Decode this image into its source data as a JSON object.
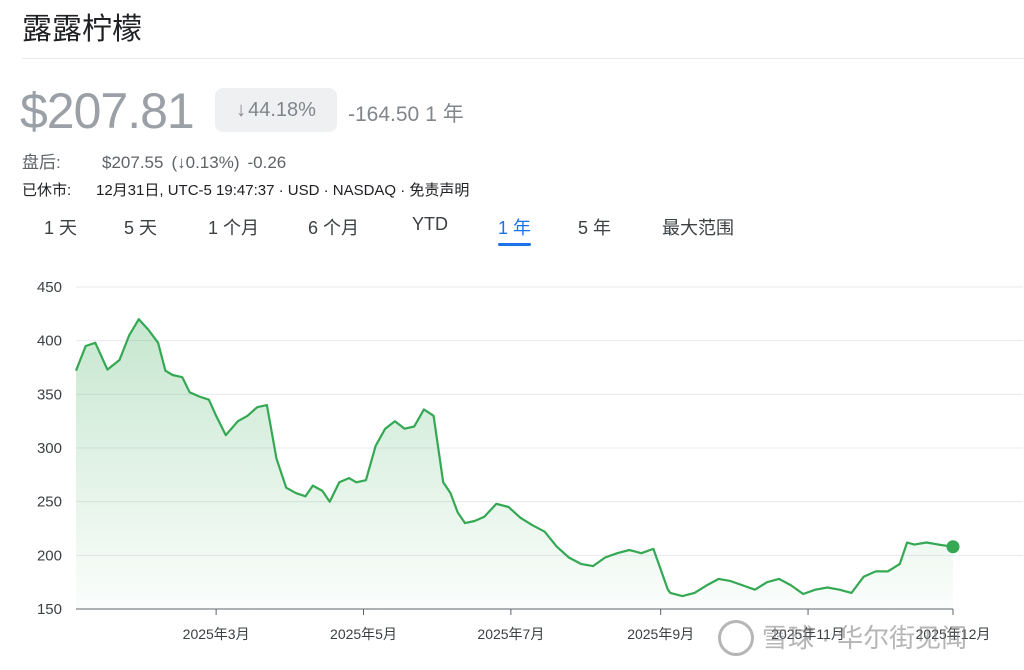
{
  "header": {
    "title": "露露柠檬"
  },
  "quote": {
    "price": "$207.81",
    "change_percent": "44.18%",
    "change_arrow": "↓",
    "change_abs": "-164.50",
    "period": "1 年"
  },
  "after_hours": {
    "label": "盘后:",
    "price": "$207.55",
    "change_percent": "(↓0.13%)",
    "change_abs": "-0.26"
  },
  "status": {
    "label": "已休市:",
    "text": "12月31日, UTC-5 19:47:37 · USD · NASDAQ · 免责声明"
  },
  "tabs": [
    {
      "label": "1 天",
      "active": false
    },
    {
      "label": "5 天",
      "active": false
    },
    {
      "label": "1 个月",
      "active": false
    },
    {
      "label": "6 个月",
      "active": false
    },
    {
      "label": "YTD",
      "active": false
    },
    {
      "label": "1 年",
      "active": true
    },
    {
      "label": "5 年",
      "active": false
    },
    {
      "label": "最大范围",
      "active": false
    }
  ],
  "watermark": {
    "text": "雪球 · 华尔街见闻"
  },
  "colors": {
    "line": "#34a853",
    "grid": "#e8eaed",
    "accent": "#1a73e8"
  },
  "chart_data": {
    "type": "area",
    "title": "",
    "xlabel": "",
    "ylabel": "",
    "ylim": [
      150,
      450
    ],
    "yticks": [
      150,
      200,
      250,
      300,
      350,
      400,
      450
    ],
    "xlim": [
      "2025-01-02",
      "2025-12-31"
    ],
    "xticks": [
      {
        "date": "2025-03-01",
        "label": "2025年3月"
      },
      {
        "date": "2025-05-01",
        "label": "2025年5月"
      },
      {
        "date": "2025-07-01",
        "label": "2025年7月"
      },
      {
        "date": "2025-09-01",
        "label": "2025年9月"
      },
      {
        "date": "2025-11-01",
        "label": "2025年11月"
      },
      {
        "date": "2025-12-31",
        "label": "2025年12月"
      }
    ],
    "grid": true,
    "series": [
      {
        "x": [
          "2025-01-02",
          "2025-01-06",
          "2025-01-10",
          "2025-01-15",
          "2025-01-20",
          "2025-01-24",
          "2025-01-28",
          "2025-02-01",
          "2025-02-05",
          "2025-02-08",
          "2025-02-11",
          "2025-02-15",
          "2025-02-18",
          "2025-02-22",
          "2025-02-26",
          "2025-03-01",
          "2025-03-05",
          "2025-03-10",
          "2025-03-14",
          "2025-03-18",
          "2025-03-22",
          "2025-03-26",
          "2025-03-30",
          "2025-04-03",
          "2025-04-07",
          "2025-04-10",
          "2025-04-14",
          "2025-04-17",
          "2025-04-21",
          "2025-04-25",
          "2025-04-28",
          "2025-05-02",
          "2025-05-06",
          "2025-05-10",
          "2025-05-14",
          "2025-05-18",
          "2025-05-22",
          "2025-05-26",
          "2025-05-30",
          "2025-06-03",
          "2025-06-06",
          "2025-06-09",
          "2025-06-12",
          "2025-06-16",
          "2025-06-20",
          "2025-06-25",
          "2025-06-30",
          "2025-07-05",
          "2025-07-10",
          "2025-07-15",
          "2025-07-20",
          "2025-07-25",
          "2025-07-30",
          "2025-08-04",
          "2025-08-09",
          "2025-08-14",
          "2025-08-19",
          "2025-08-24",
          "2025-08-29",
          "2025-09-04",
          "2025-09-05",
          "2025-09-10",
          "2025-09-15",
          "2025-09-20",
          "2025-09-25",
          "2025-09-30",
          "2025-10-05",
          "2025-10-10",
          "2025-10-15",
          "2025-10-20",
          "2025-10-25",
          "2025-10-30",
          "2025-11-04",
          "2025-11-09",
          "2025-11-14",
          "2025-11-19",
          "2025-11-24",
          "2025-11-29",
          "2025-12-04",
          "2025-12-09",
          "2025-12-12",
          "2025-12-15",
          "2025-12-20",
          "2025-12-25",
          "2025-12-31"
        ],
        "values": [
          372,
          395,
          398,
          373,
          382,
          405,
          420,
          410,
          398,
          372,
          368,
          366,
          352,
          348,
          345,
          330,
          312,
          325,
          330,
          338,
          340,
          290,
          263,
          258,
          255,
          265,
          260,
          250,
          268,
          272,
          268,
          270,
          302,
          318,
          325,
          318,
          320,
          336,
          330,
          268,
          258,
          240,
          230,
          232,
          236,
          248,
          245,
          235,
          228,
          222,
          208,
          198,
          192,
          190,
          198,
          202,
          205,
          202,
          206,
          168,
          165,
          162,
          165,
          172,
          178,
          176,
          172,
          168,
          175,
          178,
          172,
          164,
          168,
          170,
          168,
          165,
          180,
          185,
          185,
          192,
          212,
          210,
          212,
          210,
          208
        ]
      }
    ],
    "end_marker": 208
  }
}
